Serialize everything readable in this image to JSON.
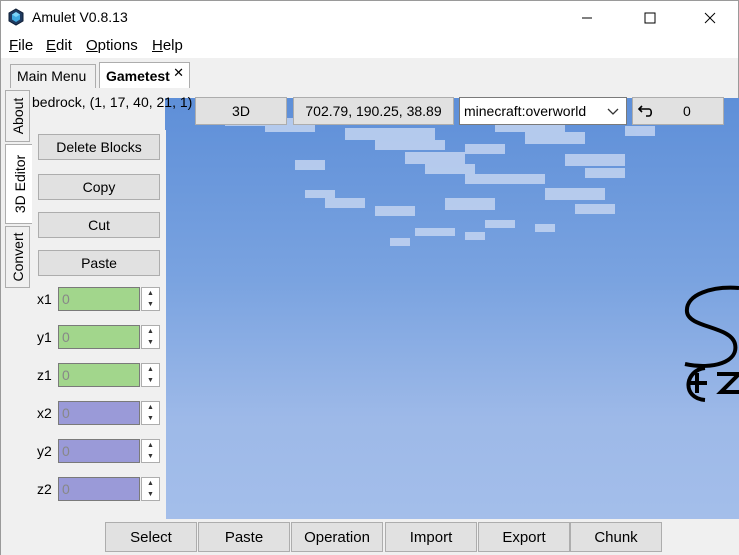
{
  "window": {
    "title": "Amulet V0.8.13"
  },
  "menu": {
    "items": [
      {
        "label": "File",
        "mnemonic": "F",
        "rest": "ile"
      },
      {
        "label": "Edit",
        "mnemonic": "E",
        "rest": "dit"
      },
      {
        "label": "Options",
        "mnemonic": "O",
        "rest": "ptions"
      },
      {
        "label": "Help",
        "mnemonic": "H",
        "rest": "elp"
      }
    ]
  },
  "tabs": {
    "main_menu": "Main Menu",
    "world": "Gametest",
    "close_glyph": "✕"
  },
  "side_tabs": {
    "about": "About",
    "editor_3d": "3D Editor",
    "convert": "Convert"
  },
  "toolbar": {
    "block_readout": "bedrock, (1, 17, 40, 21, 1)",
    "view_mode": "3D",
    "camera_position": "702.79, 190.25, 38.89",
    "dimension": "minecraft:overworld",
    "undo_count": "0"
  },
  "operations": {
    "delete_blocks": "Delete Blocks",
    "copy": "Copy",
    "cut": "Cut",
    "paste": "Paste"
  },
  "selection": {
    "x1": {
      "label": "x1",
      "placeholder": "0"
    },
    "y1": {
      "label": "y1",
      "placeholder": "0"
    },
    "z1": {
      "label": "z1",
      "placeholder": "0"
    },
    "x2": {
      "label": "x2",
      "placeholder": "0"
    },
    "y2": {
      "label": "y2",
      "placeholder": "0"
    },
    "z2": {
      "label": "z2",
      "placeholder": "0"
    }
  },
  "bottom_tools": {
    "select": "Select",
    "paste": "Paste",
    "operation": "Operation",
    "import": "Import",
    "export": "Export",
    "chunk": "Chunk"
  },
  "colors": {
    "corner1_fill": "#a2d68c",
    "corner2_fill": "#9a9ad8",
    "sky_top": "#5e8fd8",
    "sky_bottom": "#a6c0eb"
  },
  "icons": [
    "amulet-logo-icon",
    "minimize-icon",
    "maximize-icon",
    "close-icon",
    "chevron-down-icon",
    "undo-icon",
    "spin-up-icon",
    "spin-down-icon"
  ]
}
